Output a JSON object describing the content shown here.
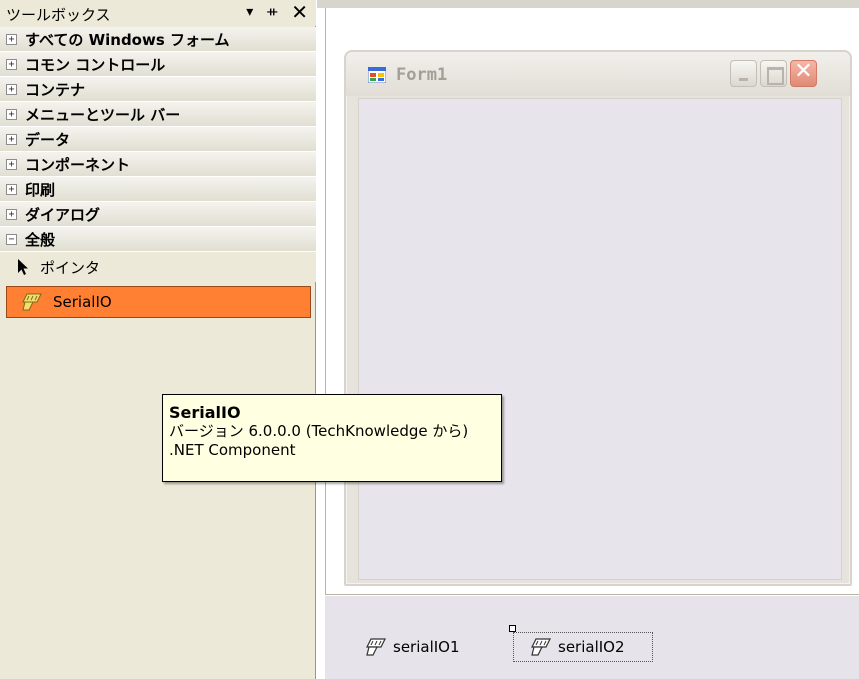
{
  "toolbox": {
    "title": "ツールボックス",
    "controls": {
      "dropdown": "▾",
      "pin": "ᚑ",
      "close": "✕"
    },
    "categories": [
      {
        "label": "すべての Windows フォーム",
        "expander": "+"
      },
      {
        "label": "コモン コントロール",
        "expander": "+"
      },
      {
        "label": "コンテナ",
        "expander": "+"
      },
      {
        "label": "メニューとツール バー",
        "expander": "+"
      },
      {
        "label": "データ",
        "expander": "+"
      },
      {
        "label": "コンポーネント",
        "expander": "+"
      },
      {
        "label": "印刷",
        "expander": "+"
      },
      {
        "label": "ダイアログ",
        "expander": "+"
      },
      {
        "label": "全般",
        "expander": "−"
      }
    ],
    "items": [
      {
        "label": "ポインタ",
        "icon": "arrow-pointer-icon"
      },
      {
        "label": "SerialIO",
        "icon": "serial-connector-icon",
        "selected": true
      }
    ],
    "selected_color": "#ff7f33"
  },
  "form": {
    "title": "Form1",
    "icon": "form-window-icon",
    "close_glyph": "✕"
  },
  "tray": {
    "components": [
      {
        "label": "serialIO1",
        "icon": "serial-connector-icon"
      },
      {
        "label": "serialIO2",
        "icon": "serial-connector-icon",
        "selected": true
      }
    ]
  },
  "tooltip": {
    "title": "SerialIO",
    "version_line": "バージョン 6.0.0.0 (TechKnowledge から)",
    "type_line": ".NET Component"
  }
}
